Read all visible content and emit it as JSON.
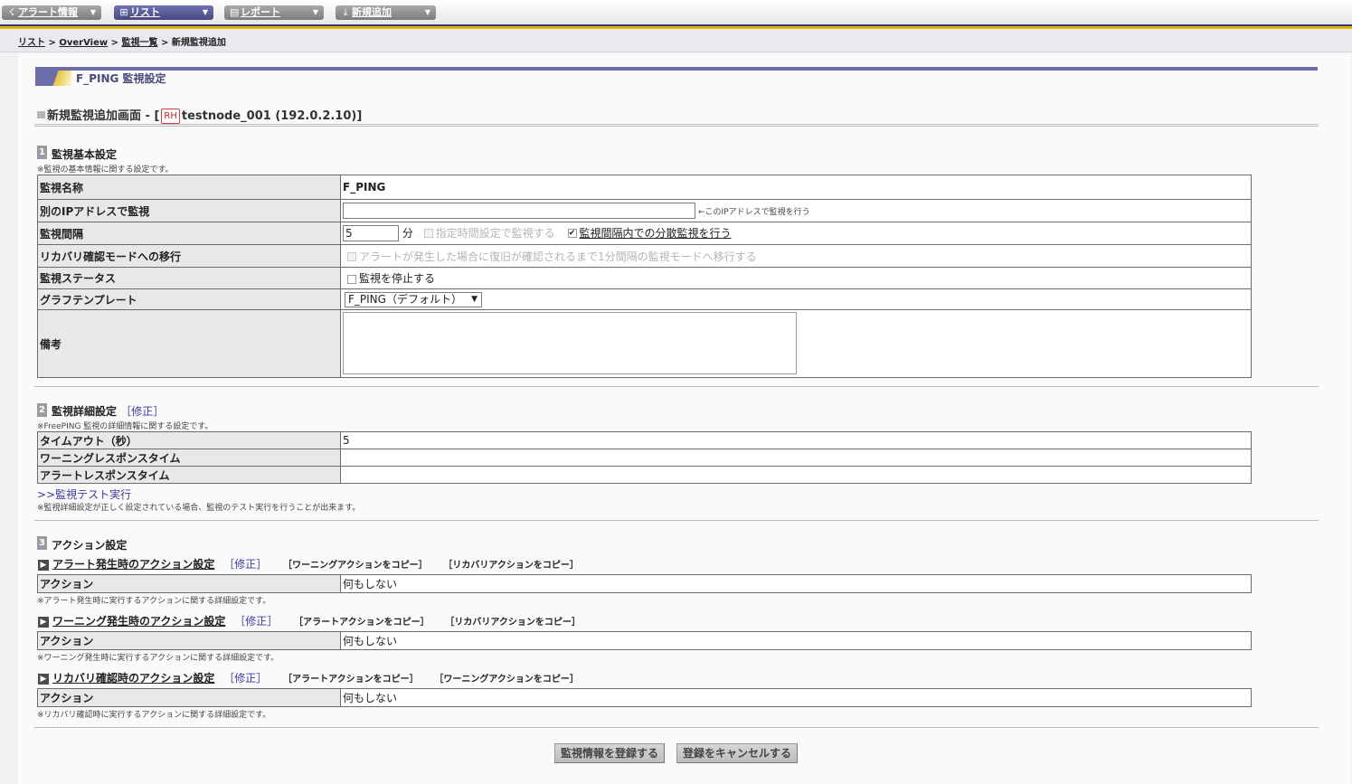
{
  "nav": {
    "items": [
      {
        "label": "アラート情報",
        "icon": "alert-icon"
      },
      {
        "label": "リスト",
        "icon": "list-icon"
      },
      {
        "label": "レポート",
        "icon": "report-icon"
      },
      {
        "label": "新規追加",
        "icon": "add-icon"
      }
    ],
    "active": "リスト"
  },
  "breadcrumb": {
    "items": [
      "リスト",
      "OverView",
      "監視一覧",
      "新規監視追加"
    ],
    "separator": ">"
  },
  "page_title": "F_PING 監視設定",
  "subtitle": {
    "prefix": "新規監視追加画面 - [",
    "badge": "RH",
    "node": "testnode_001 (192.0.2.10)]"
  },
  "section1": {
    "number": "1",
    "title": "監視基本設定",
    "note": "※監視の基本情報に関する設定です。",
    "rows": {
      "name_label": "監視名称",
      "name_value": "F_PING",
      "ip_label": "別のIPアドレスで監視",
      "ip_value": "",
      "ip_hint": "←このIPアドレスで監視を行う",
      "interval_label": "監視間隔",
      "interval_value": "5",
      "interval_unit": "分",
      "scheduled_label": "指定時間設定で監視する",
      "distributed_label": "監視間隔内での分散監視を行う",
      "recovery_label": "リカバリ確認モードへの移行",
      "recovery_option": "アラートが発生した場合に復旧が確認されるまで1分間隔の監視モードへ移行する",
      "status_label": "監視ステータス",
      "stop_label": "監視を停止する",
      "template_label": "グラフテンプレート",
      "template_value": "F_PING（デフォルト）",
      "remarks_label": "備考",
      "remarks_value": ""
    }
  },
  "section2": {
    "number": "2",
    "title": "監視詳細設定",
    "fix_label": "［修正］",
    "note": "※FreePING 監視の詳細情報に関する設定です。",
    "rows": [
      {
        "label": "タイムアウト（秒）",
        "value": "5"
      },
      {
        "label": "ワーニングレスポンスタイム",
        "value": ""
      },
      {
        "label": "アラートレスポンスタイム",
        "value": ""
      }
    ],
    "test_link": ">>監視テスト実行",
    "test_note": "※監視詳細設定が正しく設定されている場合、監視のテスト実行を行うことが出来ます。"
  },
  "section3": {
    "number": "3",
    "title": "アクション設定",
    "groups": [
      {
        "title": "アラート発生時のアクション設定",
        "fix": "［修正］",
        "copy1": "［ワーニングアクションをコピー］",
        "copy2": "［リカバリアクションをコピー］",
        "row_label": "アクション",
        "row_value": "何もしない",
        "note": "※アラート発生時に実行するアクションに関する詳細設定です。"
      },
      {
        "title": "ワーニング発生時のアクション設定",
        "fix": "［修正］",
        "copy1": "［アラートアクションをコピー］",
        "copy2": "［リカバリアクションをコピー］",
        "row_label": "アクション",
        "row_value": "何もしない",
        "note": "※ワーニング発生時に実行するアクションに関する詳細設定です。"
      },
      {
        "title": "リカバリ確認時のアクション設定",
        "fix": "［修正］",
        "copy1": "［アラートアクションをコピー］",
        "copy2": "［ワーニングアクションをコピー］",
        "row_label": "アクション",
        "row_value": "何もしない",
        "note": "※リカバリ確認時に実行するアクションに関する詳細設定です。"
      }
    ]
  },
  "buttons": {
    "register": "監視情報を登録する",
    "cancel": "登録をキャンセルする"
  },
  "colors": {
    "nav_active": "#5a5c96",
    "accent_line": "#e1b500",
    "link": "#3a3aa0"
  }
}
